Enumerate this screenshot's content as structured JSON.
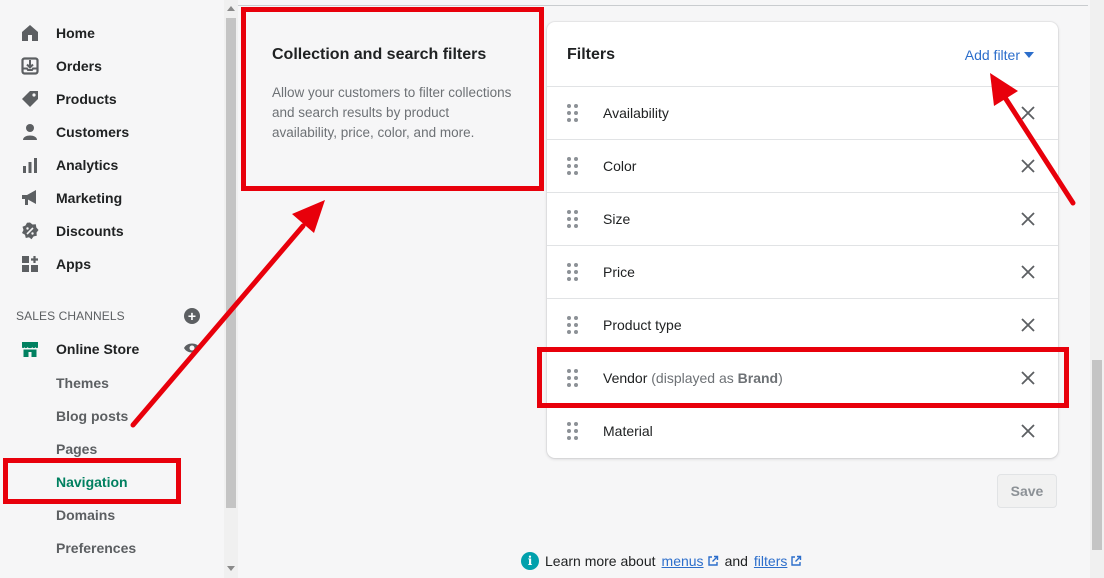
{
  "sidebar": {
    "items": [
      {
        "label": "Home",
        "icon": "home-icon"
      },
      {
        "label": "Orders",
        "icon": "orders-icon"
      },
      {
        "label": "Products",
        "icon": "tag-icon"
      },
      {
        "label": "Customers",
        "icon": "person-icon"
      },
      {
        "label": "Analytics",
        "icon": "bar-chart-icon"
      },
      {
        "label": "Marketing",
        "icon": "megaphone-icon"
      },
      {
        "label": "Discounts",
        "icon": "discount-icon"
      },
      {
        "label": "Apps",
        "icon": "apps-icon"
      }
    ],
    "sales_channels_heading": "SALES CHANNELS",
    "online_store": {
      "label": "Online Store",
      "icon": "store-icon"
    },
    "sub_items": [
      "Themes",
      "Blog posts",
      "Pages",
      "Navigation",
      "Domains",
      "Preferences"
    ],
    "active_sub_item": "Navigation"
  },
  "description": {
    "title": "Collection and search filters",
    "text": "Allow your customers to filter collections and search results by product availability, price, color, and more."
  },
  "filters_card": {
    "title": "Filters",
    "add_filter_label": "Add filter",
    "rows": [
      {
        "label": "Availability"
      },
      {
        "label": "Color"
      },
      {
        "label": "Size"
      },
      {
        "label": "Price"
      },
      {
        "label": "Product type"
      },
      {
        "label": "Vendor",
        "note_prefix": "(displayed as ",
        "note_bold": "Brand",
        "note_suffix": ")"
      },
      {
        "label": "Material"
      }
    ]
  },
  "save_label": "Save",
  "footer": {
    "prefix": "Learn more about",
    "link1": "menus",
    "middle": "and",
    "link2": "filters"
  },
  "colors": {
    "accent_green": "#008060",
    "link_blue": "#2c6ecb",
    "annotation_red": "#e8000b",
    "info_teal": "#00a0ac"
  }
}
